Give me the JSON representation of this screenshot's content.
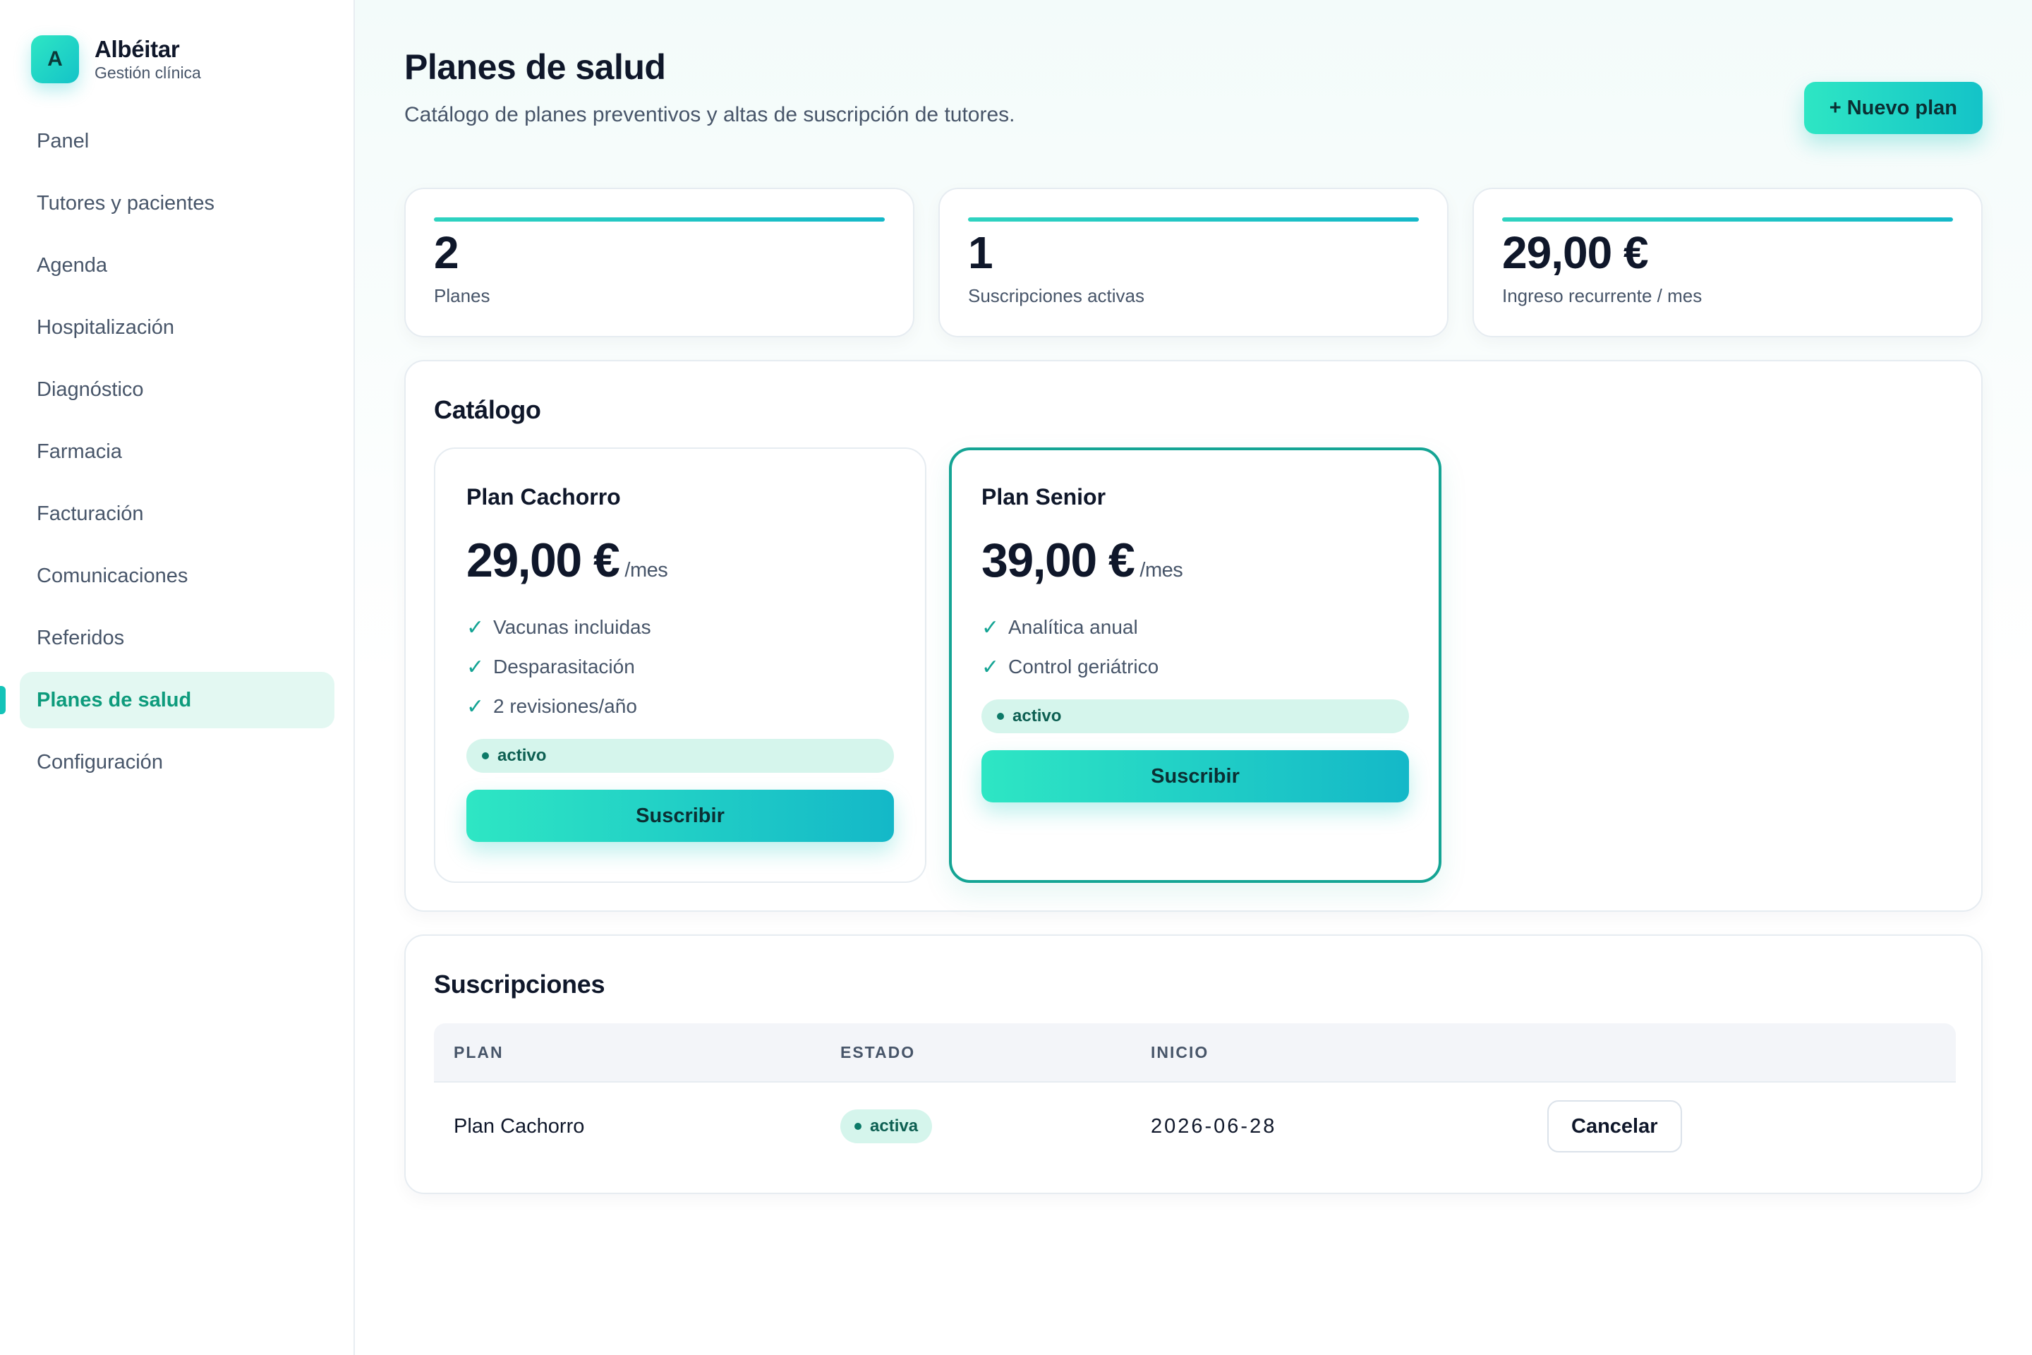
{
  "brand": {
    "logo_letter": "A",
    "name": "Albéitar",
    "subtitle": "Gestión clínica"
  },
  "sidebar": {
    "items": [
      {
        "label": "Panel"
      },
      {
        "label": "Tutores y pacientes"
      },
      {
        "label": "Agenda"
      },
      {
        "label": "Hospitalización"
      },
      {
        "label": "Diagnóstico"
      },
      {
        "label": "Farmacia"
      },
      {
        "label": "Facturación"
      },
      {
        "label": "Comunicaciones"
      },
      {
        "label": "Referidos"
      },
      {
        "label": "Planes de salud",
        "active": true
      },
      {
        "label": "Configuración"
      }
    ]
  },
  "header": {
    "title": "Planes de salud",
    "subtitle": "Catálogo de planes preventivos y altas de suscripción de tutores.",
    "new_plan_label": "+ Nuevo plan"
  },
  "stats": [
    {
      "value": "2",
      "label": "Planes"
    },
    {
      "value": "1",
      "label": "Suscripciones activas"
    },
    {
      "value": "29,00 €",
      "label": "Ingreso recurrente / mes"
    }
  ],
  "catalog": {
    "title": "Catálogo",
    "plans": [
      {
        "name": "Plan Cachorro",
        "price": "29,00 €",
        "period": "/mes",
        "features": [
          "Vacunas incluidas",
          "Desparasitación",
          "2 revisiones/año"
        ],
        "status": "activo",
        "subscribe_label": "Suscribir"
      },
      {
        "name": "Plan Senior",
        "price": "39,00 €",
        "period": "/mes",
        "features": [
          "Analítica anual",
          "Control geriátrico"
        ],
        "status": "activo",
        "subscribe_label": "Suscribir"
      }
    ]
  },
  "subscriptions": {
    "title": "Suscripciones",
    "columns": [
      "PLAN",
      "ESTADO",
      "INICIO"
    ],
    "rows": [
      {
        "plan": "Plan Cachorro",
        "status": "activa",
        "start": "2026-06-28",
        "action_label": "Cancelar"
      }
    ]
  },
  "colors": {
    "accent": "#14c3c8",
    "accent_start": "#2ee6c4",
    "featured_border": "#14a494",
    "active_nav_bg": "#e3f8f2",
    "active_nav_text": "#0d9b7c",
    "badge_bg": "#d5f5ec"
  },
  "icons": {
    "check": "check-icon",
    "status_dot": "status-dot-icon"
  }
}
